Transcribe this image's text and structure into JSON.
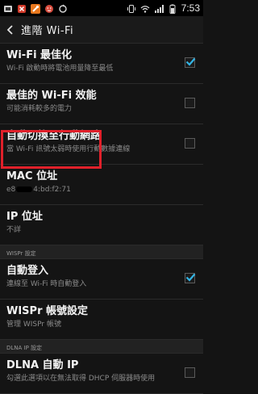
{
  "status_bar": {
    "time": "7:53",
    "left_icons": [
      "app-icon",
      "cancel-icon",
      "wrench-icon",
      "face-icon",
      "sync-icon"
    ],
    "right_icons": [
      "vibrate-icon",
      "wifi-icon",
      "signal-icon",
      "battery-icon"
    ]
  },
  "header": {
    "title": "進階 Wi-Fi"
  },
  "settings": [
    {
      "title": "Wi-Fi 最佳化",
      "subtitle": "Wi-Fi 啟動時將電池用量降至最低",
      "checked": true
    },
    {
      "title": "最佳的 Wi-Fi 效能",
      "subtitle": "可能消耗較多的電力",
      "checked": false
    },
    {
      "title": "自動切換至行動網路",
      "subtitle": "當 Wi-Fi 訊號太弱時使用行動數據連線",
      "checked": false
    },
    {
      "title": "MAC 位址",
      "subtitle_prefix": "e8",
      "subtitle_suffix": "4:bd:f2:71"
    },
    {
      "title": "IP 位址",
      "subtitle": "不詳"
    }
  ],
  "section_wispr": "WISPr 設定",
  "wispr_items": [
    {
      "title": "自動登入",
      "subtitle": "連線至 Wi-Fi 時自動登入",
      "checked": true
    },
    {
      "title": "WISPr 帳號設定",
      "subtitle": "管理 WISPr 帳號"
    }
  ],
  "section_dlna": "DLNA IP 設定",
  "dlna_items": [
    {
      "title": "DLNA 自動 IP",
      "subtitle": "勾選此選項以在無法取得 DHCP 伺服器時使用",
      "checked": false
    }
  ],
  "colors": {
    "accent": "#33b5e5",
    "highlight": "#e0202a",
    "background": "#141414"
  }
}
